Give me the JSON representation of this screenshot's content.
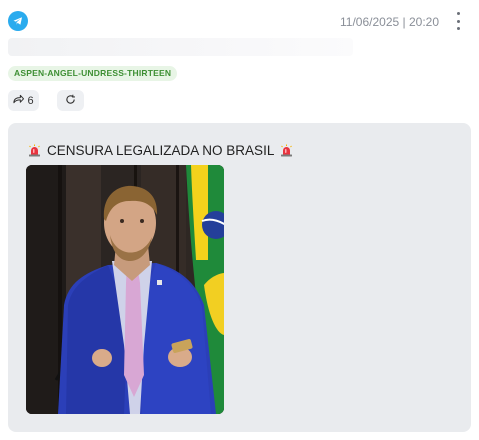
{
  "header": {
    "icon": "telegram-icon",
    "timestamp": "11/06/2025 | 20:20",
    "menu_icon": "kebab-menu-icon"
  },
  "tag": {
    "label": "ASPEN-ANGEL-UNDRESS-THIRTEEN",
    "color": "#3d8f33"
  },
  "actions": {
    "forward": {
      "icon": "forward-icon",
      "count": "6"
    },
    "refresh": {
      "icon": "refresh-icon"
    }
  },
  "message": {
    "text": "CENSURA LEGALIZADA NO BRASIL",
    "emoji": "police-siren",
    "media": "photo"
  },
  "colors": {
    "accent": "#2aabee",
    "bubble": "#e9ebee",
    "tag_bg": "#e8f5e6"
  }
}
